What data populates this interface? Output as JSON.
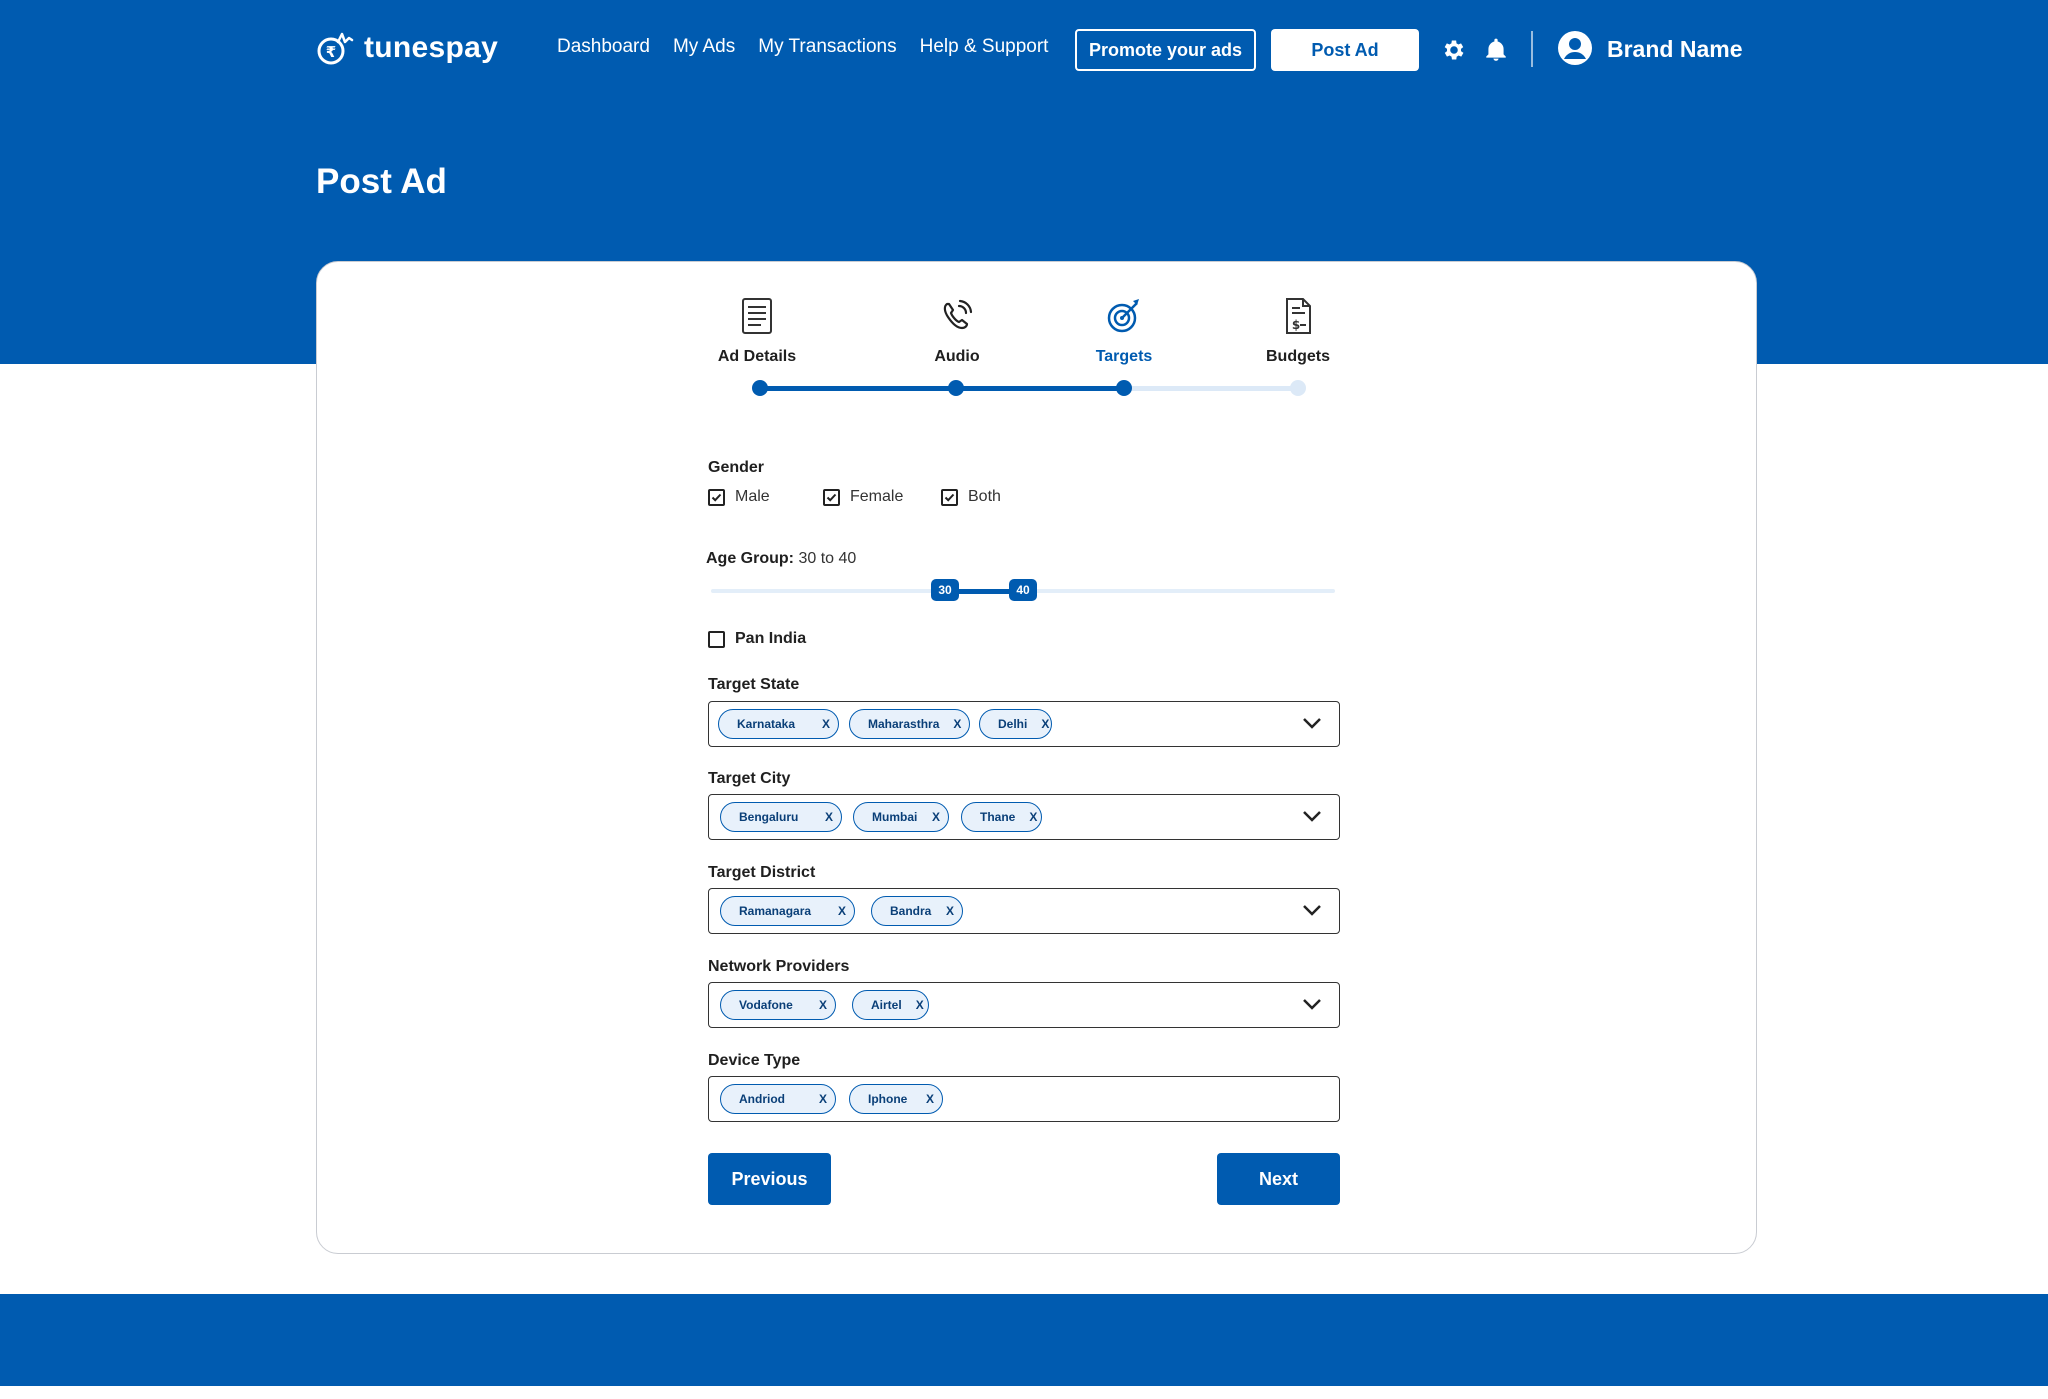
{
  "app": {
    "name": "tunespay"
  },
  "nav": {
    "items": [
      "Dashboard",
      "My Ads",
      "My Transactions",
      "Help & Support"
    ],
    "promote_label": "Promote your ads",
    "post_ad_label": "Post Ad",
    "user_name": "Brand Name"
  },
  "page": {
    "title": "Post Ad"
  },
  "stepper": {
    "steps": [
      {
        "label": "Ad Details",
        "icon": "document-icon",
        "state": "done"
      },
      {
        "label": "Audio",
        "icon": "phone-audio-icon",
        "state": "done"
      },
      {
        "label": "Targets",
        "icon": "target-icon",
        "state": "active"
      },
      {
        "label": "Budgets",
        "icon": "invoice-icon",
        "state": "pending"
      }
    ]
  },
  "form": {
    "gender": {
      "label": "Gender",
      "options": [
        {
          "label": "Male",
          "checked": true
        },
        {
          "label": "Female",
          "checked": true
        },
        {
          "label": "Both",
          "checked": true
        }
      ]
    },
    "age_group": {
      "label": "Age Group:",
      "value_text": "30 to 40",
      "min": 30,
      "max": 40
    },
    "pan_india": {
      "label": "Pan India",
      "checked": false
    },
    "target_state": {
      "label": "Target State",
      "chips": [
        "Karnataka",
        "Maharasthra",
        "Delhi"
      ]
    },
    "target_city": {
      "label": "Target City",
      "chips": [
        "Bengaluru",
        "Mumbai",
        "Thane"
      ]
    },
    "target_district": {
      "label": "Target District",
      "chips": [
        "Ramanagara",
        "Bandra"
      ]
    },
    "network_providers": {
      "label": "Network Providers",
      "chips": [
        "Vodafone",
        "Airtel"
      ]
    },
    "device_type": {
      "label": "Device Type",
      "chips": [
        "Andriod",
        "Iphone"
      ]
    },
    "chip_remove": "X",
    "previous_label": "Previous",
    "next_label": "Next"
  },
  "colors": {
    "primary": "#005bb0",
    "chip_bg": "#e8f1fb",
    "track_pending": "#dce9f7"
  }
}
